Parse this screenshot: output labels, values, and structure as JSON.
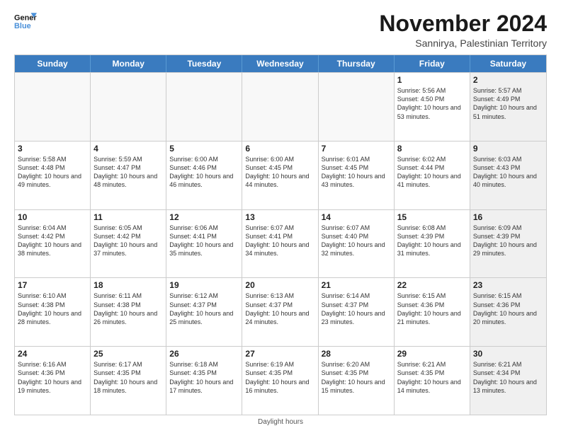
{
  "header": {
    "logo_line1": "General",
    "logo_line2": "Blue",
    "title": "November 2024",
    "location": "Sannirya, Palestinian Territory"
  },
  "days_of_week": [
    "Sunday",
    "Monday",
    "Tuesday",
    "Wednesday",
    "Thursday",
    "Friday",
    "Saturday"
  ],
  "weeks": [
    [
      {
        "day": "",
        "text": "",
        "shaded": true
      },
      {
        "day": "",
        "text": "",
        "shaded": true
      },
      {
        "day": "",
        "text": "",
        "shaded": true
      },
      {
        "day": "",
        "text": "",
        "shaded": true
      },
      {
        "day": "",
        "text": "",
        "shaded": true
      },
      {
        "day": "1",
        "text": "Sunrise: 5:56 AM\nSunset: 4:50 PM\nDaylight: 10 hours and 53 minutes.",
        "shaded": false
      },
      {
        "day": "2",
        "text": "Sunrise: 5:57 AM\nSunset: 4:49 PM\nDaylight: 10 hours and 51 minutes.",
        "shaded": true
      }
    ],
    [
      {
        "day": "3",
        "text": "Sunrise: 5:58 AM\nSunset: 4:48 PM\nDaylight: 10 hours and 49 minutes.",
        "shaded": false
      },
      {
        "day": "4",
        "text": "Sunrise: 5:59 AM\nSunset: 4:47 PM\nDaylight: 10 hours and 48 minutes.",
        "shaded": false
      },
      {
        "day": "5",
        "text": "Sunrise: 6:00 AM\nSunset: 4:46 PM\nDaylight: 10 hours and 46 minutes.",
        "shaded": false
      },
      {
        "day": "6",
        "text": "Sunrise: 6:00 AM\nSunset: 4:45 PM\nDaylight: 10 hours and 44 minutes.",
        "shaded": false
      },
      {
        "day": "7",
        "text": "Sunrise: 6:01 AM\nSunset: 4:45 PM\nDaylight: 10 hours and 43 minutes.",
        "shaded": false
      },
      {
        "day": "8",
        "text": "Sunrise: 6:02 AM\nSunset: 4:44 PM\nDaylight: 10 hours and 41 minutes.",
        "shaded": false
      },
      {
        "day": "9",
        "text": "Sunrise: 6:03 AM\nSunset: 4:43 PM\nDaylight: 10 hours and 40 minutes.",
        "shaded": true
      }
    ],
    [
      {
        "day": "10",
        "text": "Sunrise: 6:04 AM\nSunset: 4:42 PM\nDaylight: 10 hours and 38 minutes.",
        "shaded": false
      },
      {
        "day": "11",
        "text": "Sunrise: 6:05 AM\nSunset: 4:42 PM\nDaylight: 10 hours and 37 minutes.",
        "shaded": false
      },
      {
        "day": "12",
        "text": "Sunrise: 6:06 AM\nSunset: 4:41 PM\nDaylight: 10 hours and 35 minutes.",
        "shaded": false
      },
      {
        "day": "13",
        "text": "Sunrise: 6:07 AM\nSunset: 4:41 PM\nDaylight: 10 hours and 34 minutes.",
        "shaded": false
      },
      {
        "day": "14",
        "text": "Sunrise: 6:07 AM\nSunset: 4:40 PM\nDaylight: 10 hours and 32 minutes.",
        "shaded": false
      },
      {
        "day": "15",
        "text": "Sunrise: 6:08 AM\nSunset: 4:39 PM\nDaylight: 10 hours and 31 minutes.",
        "shaded": false
      },
      {
        "day": "16",
        "text": "Sunrise: 6:09 AM\nSunset: 4:39 PM\nDaylight: 10 hours and 29 minutes.",
        "shaded": true
      }
    ],
    [
      {
        "day": "17",
        "text": "Sunrise: 6:10 AM\nSunset: 4:38 PM\nDaylight: 10 hours and 28 minutes.",
        "shaded": false
      },
      {
        "day": "18",
        "text": "Sunrise: 6:11 AM\nSunset: 4:38 PM\nDaylight: 10 hours and 26 minutes.",
        "shaded": false
      },
      {
        "day": "19",
        "text": "Sunrise: 6:12 AM\nSunset: 4:37 PM\nDaylight: 10 hours and 25 minutes.",
        "shaded": false
      },
      {
        "day": "20",
        "text": "Sunrise: 6:13 AM\nSunset: 4:37 PM\nDaylight: 10 hours and 24 minutes.",
        "shaded": false
      },
      {
        "day": "21",
        "text": "Sunrise: 6:14 AM\nSunset: 4:37 PM\nDaylight: 10 hours and 23 minutes.",
        "shaded": false
      },
      {
        "day": "22",
        "text": "Sunrise: 6:15 AM\nSunset: 4:36 PM\nDaylight: 10 hours and 21 minutes.",
        "shaded": false
      },
      {
        "day": "23",
        "text": "Sunrise: 6:15 AM\nSunset: 4:36 PM\nDaylight: 10 hours and 20 minutes.",
        "shaded": true
      }
    ],
    [
      {
        "day": "24",
        "text": "Sunrise: 6:16 AM\nSunset: 4:36 PM\nDaylight: 10 hours and 19 minutes.",
        "shaded": false
      },
      {
        "day": "25",
        "text": "Sunrise: 6:17 AM\nSunset: 4:35 PM\nDaylight: 10 hours and 18 minutes.",
        "shaded": false
      },
      {
        "day": "26",
        "text": "Sunrise: 6:18 AM\nSunset: 4:35 PM\nDaylight: 10 hours and 17 minutes.",
        "shaded": false
      },
      {
        "day": "27",
        "text": "Sunrise: 6:19 AM\nSunset: 4:35 PM\nDaylight: 10 hours and 16 minutes.",
        "shaded": false
      },
      {
        "day": "28",
        "text": "Sunrise: 6:20 AM\nSunset: 4:35 PM\nDaylight: 10 hours and 15 minutes.",
        "shaded": false
      },
      {
        "day": "29",
        "text": "Sunrise: 6:21 AM\nSunset: 4:35 PM\nDaylight: 10 hours and 14 minutes.",
        "shaded": false
      },
      {
        "day": "30",
        "text": "Sunrise: 6:21 AM\nSunset: 4:34 PM\nDaylight: 10 hours and 13 minutes.",
        "shaded": true
      }
    ]
  ],
  "footer": "Daylight hours"
}
